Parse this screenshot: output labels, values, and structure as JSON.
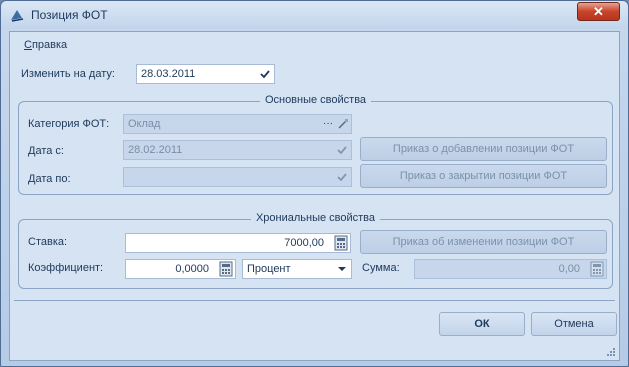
{
  "window": {
    "title": "Позиция ФОТ",
    "close_glyph": "✕"
  },
  "menu": {
    "help_underlined": "С",
    "help_rest": "правка"
  },
  "change_date": {
    "label": "Изменить на дату:",
    "value": "28.03.2011"
  },
  "main_group": {
    "title": "Основные свойства",
    "category_label": "Категория ФОТ:",
    "category_value": "Оклад",
    "ellipsis": "···",
    "date_from_label": "Дата с:",
    "date_from_value": "28.02.2011",
    "date_to_label": "Дата по:",
    "date_to_value": "",
    "add_order_button": "Приказ о добавлении позиции ФОТ",
    "close_order_button": "Приказ о закрытии позиции ФОТ"
  },
  "chrono_group": {
    "title": "Хрониальные свойства",
    "rate_label": "Ставка:",
    "rate_value": "7000,00",
    "change_order_button": "Приказ об изменении позиции ФОТ",
    "coef_label": "Коэффициент:",
    "coef_value": "0,0000",
    "unit_value": "Процент",
    "sum_label": "Сумма:",
    "sum_value": "0,00"
  },
  "footer": {
    "ok_label": "ОК",
    "cancel_label": "Отмена"
  },
  "colors": {
    "accent": "#1e395b",
    "close": "#c7432a",
    "background": "#d6e3f3"
  }
}
